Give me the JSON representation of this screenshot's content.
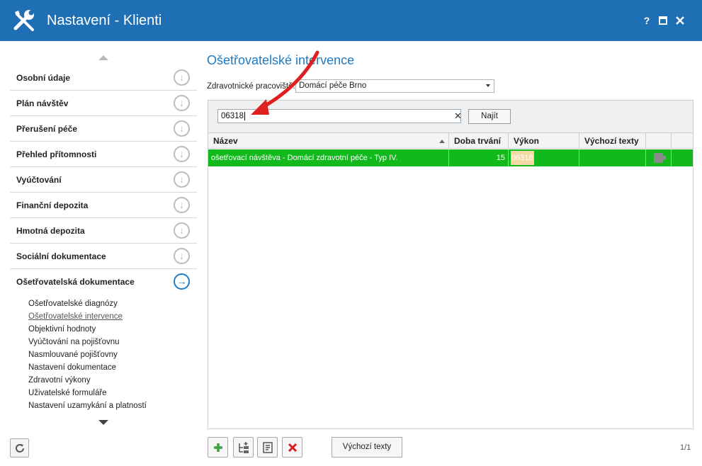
{
  "window": {
    "title": "Nastavení - Klienti",
    "help_label": "?",
    "maximize_label": "■",
    "close_label": "✕",
    "icon": "wrench-screwdriver-icon"
  },
  "sidebar": {
    "items": [
      {
        "label": "Osobní údaje"
      },
      {
        "label": "Plán návštěv"
      },
      {
        "label": "Přerušení péče"
      },
      {
        "label": "Přehled přítomnosti"
      },
      {
        "label": "Vyúčtování"
      },
      {
        "label": "Finanční depozita"
      },
      {
        "label": "Hmotná depozita"
      },
      {
        "label": "Sociální dokumentace"
      },
      {
        "label": "Ošetřovatelská dokumentace"
      }
    ],
    "subitems": [
      {
        "label": "Ošetřovatelské diagnózy"
      },
      {
        "label": "Ošetřovatelské intervence"
      },
      {
        "label": "Objektivní hodnoty"
      },
      {
        "label": "Vyúčtování na pojišťovnu"
      },
      {
        "label": "Nasmlouvané pojišťovny"
      },
      {
        "label": "Nastavení dokumentace"
      },
      {
        "label": "Zdravotní výkony"
      },
      {
        "label": "Uživatelské formuláře"
      },
      {
        "label": "Nastavení uzamykání a platností"
      }
    ]
  },
  "main": {
    "heading": "Ošetřovatelské intervence",
    "workplace_label": "Zdravotnické pracoviště:",
    "workplace_value": "Domácí péče Brno",
    "search_value": "06318",
    "search_button": "Najít",
    "columns": [
      "Název",
      "Doba trvání",
      "Výkon",
      "Výchozí texty"
    ],
    "rows": [
      {
        "name": "ošetřovací návštěva - Domácí zdravotní péče - Typ IV.",
        "duration": "15",
        "code": "06318",
        "default_texts": ""
      }
    ],
    "default_texts_button": "Výchozí texty",
    "pager": "1/1"
  },
  "colors": {
    "titlebar": "#1f6fb5",
    "accent": "#1f7bc4",
    "selected_row": "#12b91c",
    "annotation_arrow": "#e02020"
  }
}
